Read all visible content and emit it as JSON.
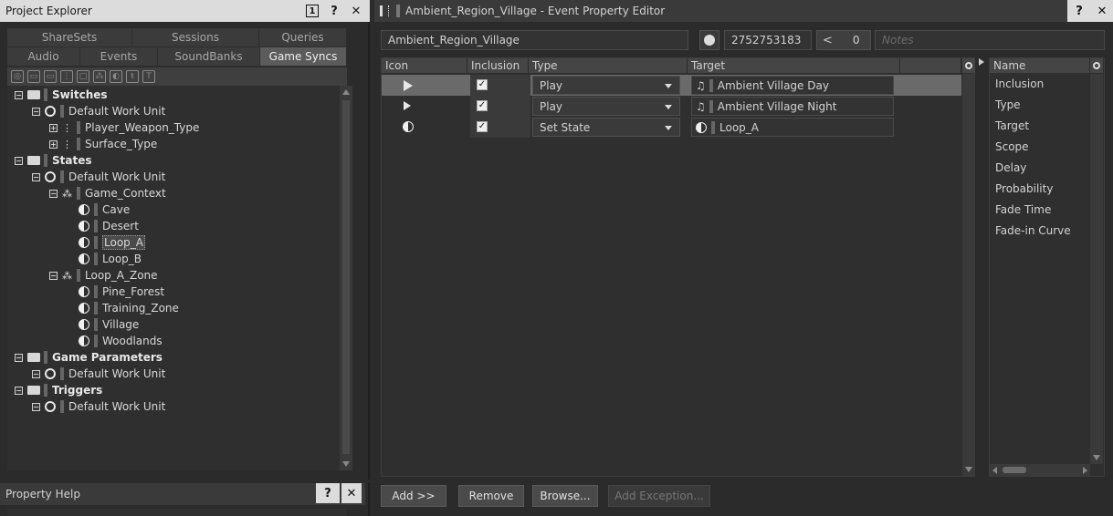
{
  "project_explorer": {
    "title": "Project Explorer",
    "badge": "1",
    "help": "?",
    "close": "✕",
    "tabs_row1": [
      "ShareSets",
      "Sessions",
      "Queries"
    ],
    "tabs_row2": [
      "Audio",
      "Events",
      "SoundBanks",
      "Game Syncs"
    ],
    "active_tab": "Game Syncs",
    "tree": [
      {
        "label": "Switches",
        "level": 0,
        "kind": "folder"
      },
      {
        "label": "Default Work Unit",
        "level": 1,
        "kind": "workunit"
      },
      {
        "label": "Player_Weapon_Type",
        "level": 2,
        "kind": "switchgroup"
      },
      {
        "label": "Surface_Type",
        "level": 2,
        "kind": "switchgroup"
      },
      {
        "label": "States",
        "level": 0,
        "kind": "folder"
      },
      {
        "label": "Default Work Unit",
        "level": 1,
        "kind": "workunit"
      },
      {
        "label": "Game_Context",
        "level": 2,
        "kind": "stategroup"
      },
      {
        "label": "Cave",
        "level": 3,
        "kind": "state"
      },
      {
        "label": "Desert",
        "level": 3,
        "kind": "state"
      },
      {
        "label": "Loop_A",
        "level": 3,
        "kind": "state",
        "selected": true
      },
      {
        "label": "Loop_B",
        "level": 3,
        "kind": "state"
      },
      {
        "label": "Loop_A_Zone",
        "level": 2,
        "kind": "stategroup"
      },
      {
        "label": "Pine_Forest",
        "level": 3,
        "kind": "state"
      },
      {
        "label": "Training_Zone",
        "level": 3,
        "kind": "state"
      },
      {
        "label": "Village",
        "level": 3,
        "kind": "state"
      },
      {
        "label": "Woodlands",
        "level": 3,
        "kind": "state"
      },
      {
        "label": "Game Parameters",
        "level": 0,
        "kind": "folder"
      },
      {
        "label": "Default Work Unit",
        "level": 1,
        "kind": "workunit"
      },
      {
        "label": "Triggers",
        "level": 0,
        "kind": "folder"
      },
      {
        "label": "Default Work Unit",
        "level": 1,
        "kind": "workunit"
      }
    ]
  },
  "property_help": {
    "title": "Property Help",
    "help": "?",
    "close": "✕"
  },
  "editor": {
    "title": "Ambient_Region_Village - Event Property Editor",
    "help": "?",
    "close": "✕",
    "name_value": "Ambient_Region_Village",
    "id_value": "2752753183",
    "share_count": "0",
    "notes_placeholder": "Notes",
    "columns": [
      "Icon",
      "Inclusion",
      "Type",
      "Target"
    ],
    "actions": [
      {
        "type": "Play",
        "target": "Ambient Village Day",
        "included": true,
        "icon": "play-icon",
        "target_icon": "sound-icon"
      },
      {
        "type": "Play",
        "target": "Ambient Village Night",
        "included": true,
        "icon": "play-icon",
        "target_icon": "sound-icon"
      },
      {
        "type": "Set State",
        "target": "Loop_A",
        "included": true,
        "icon": "state-icon",
        "target_icon": "state-icon"
      }
    ],
    "buttons": {
      "add": "Add >>",
      "remove": "Remove",
      "browse": "Browse...",
      "add_exception": "Add Exception..."
    },
    "right_list": {
      "header": "Name",
      "items": [
        "Inclusion",
        "Type",
        "Target",
        "Scope",
        "Delay",
        "Probability",
        "Fade Time",
        "Fade-in Curve"
      ]
    }
  }
}
